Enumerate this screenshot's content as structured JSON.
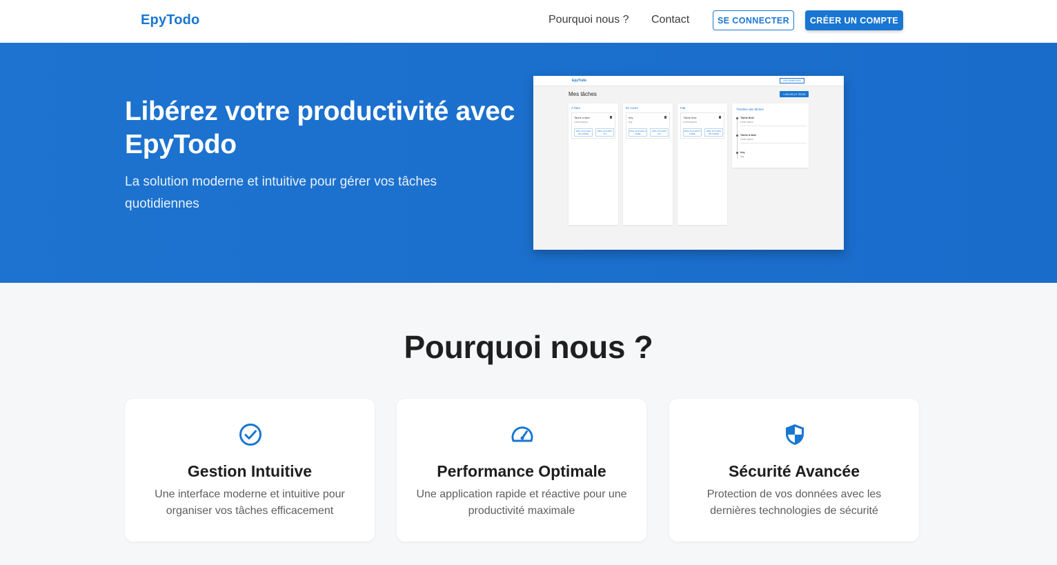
{
  "nav": {
    "brand": "EpyTodo",
    "links": [
      {
        "label": "Pourquoi nous ?"
      },
      {
        "label": "Contact"
      }
    ],
    "login_label": "SE CONNECTER",
    "signup_label": "CRÉER UN COMPTE"
  },
  "hero": {
    "title": "Libérez votre productivité avec EpyTodo",
    "subtitle": "La solution moderne et intuitive pour gérer vos tâches quotidiennes",
    "background_color": "#1a6ccb"
  },
  "preview": {
    "brand": "EpyTodo",
    "logout_label": "DÉCONNEXION",
    "page_title": "Mes tâches",
    "new_task_label": "+ NOUVELLE TÂCHE",
    "columns": [
      {
        "title": "À faire",
        "card": {
          "name": "Tache à faire",
          "desc": "Lorem Ipsum",
          "chip_a": "APPL 15:24 2024 DE CODER",
          "chip_b": "APPL 15:24 RDV TAT"
        }
      },
      {
        "title": "En cours",
        "card": {
          "name": "hey",
          "desc": "hey",
          "chip_a": "APPL 15:28 2024 À FAIRE",
          "chip_b": "APPL 15:24 RDV TAT"
        }
      },
      {
        "title": "Fait",
        "card": {
          "name": "Tâche finie",
          "desc": "Lorem Ipsum",
          "chip_a": "APPL 15:24 2024 À FAIRE",
          "chip_b": "APPL 15:24 RDV DE CODER"
        }
      }
    ],
    "timeline": {
      "title": "Timeline des tâches",
      "items": [
        {
          "name": "Tâche finie",
          "desc": "Lorem Ipsum"
        },
        {
          "name": "Tâche à faire",
          "desc": "Lorem Ipsum"
        },
        {
          "name": "hey",
          "desc": "hey"
        }
      ]
    }
  },
  "why": {
    "title": "Pourquoi nous ?",
    "features": [
      {
        "icon": "check-circle-icon",
        "title": "Gestion Intuitive",
        "desc": "Une interface moderne et intuitive pour organiser vos tâches efficacement"
      },
      {
        "icon": "speedometer-icon",
        "title": "Performance Optimale",
        "desc": "Une application rapide et réactive pour une productivité maximale"
      },
      {
        "icon": "shield-icon",
        "title": "Sécurité Avancée",
        "desc": "Protection de vos données avec les dernières technologies de sécurité"
      }
    ]
  },
  "colors": {
    "accent": "#1976d2",
    "page_bg": "#f6f7f9"
  }
}
